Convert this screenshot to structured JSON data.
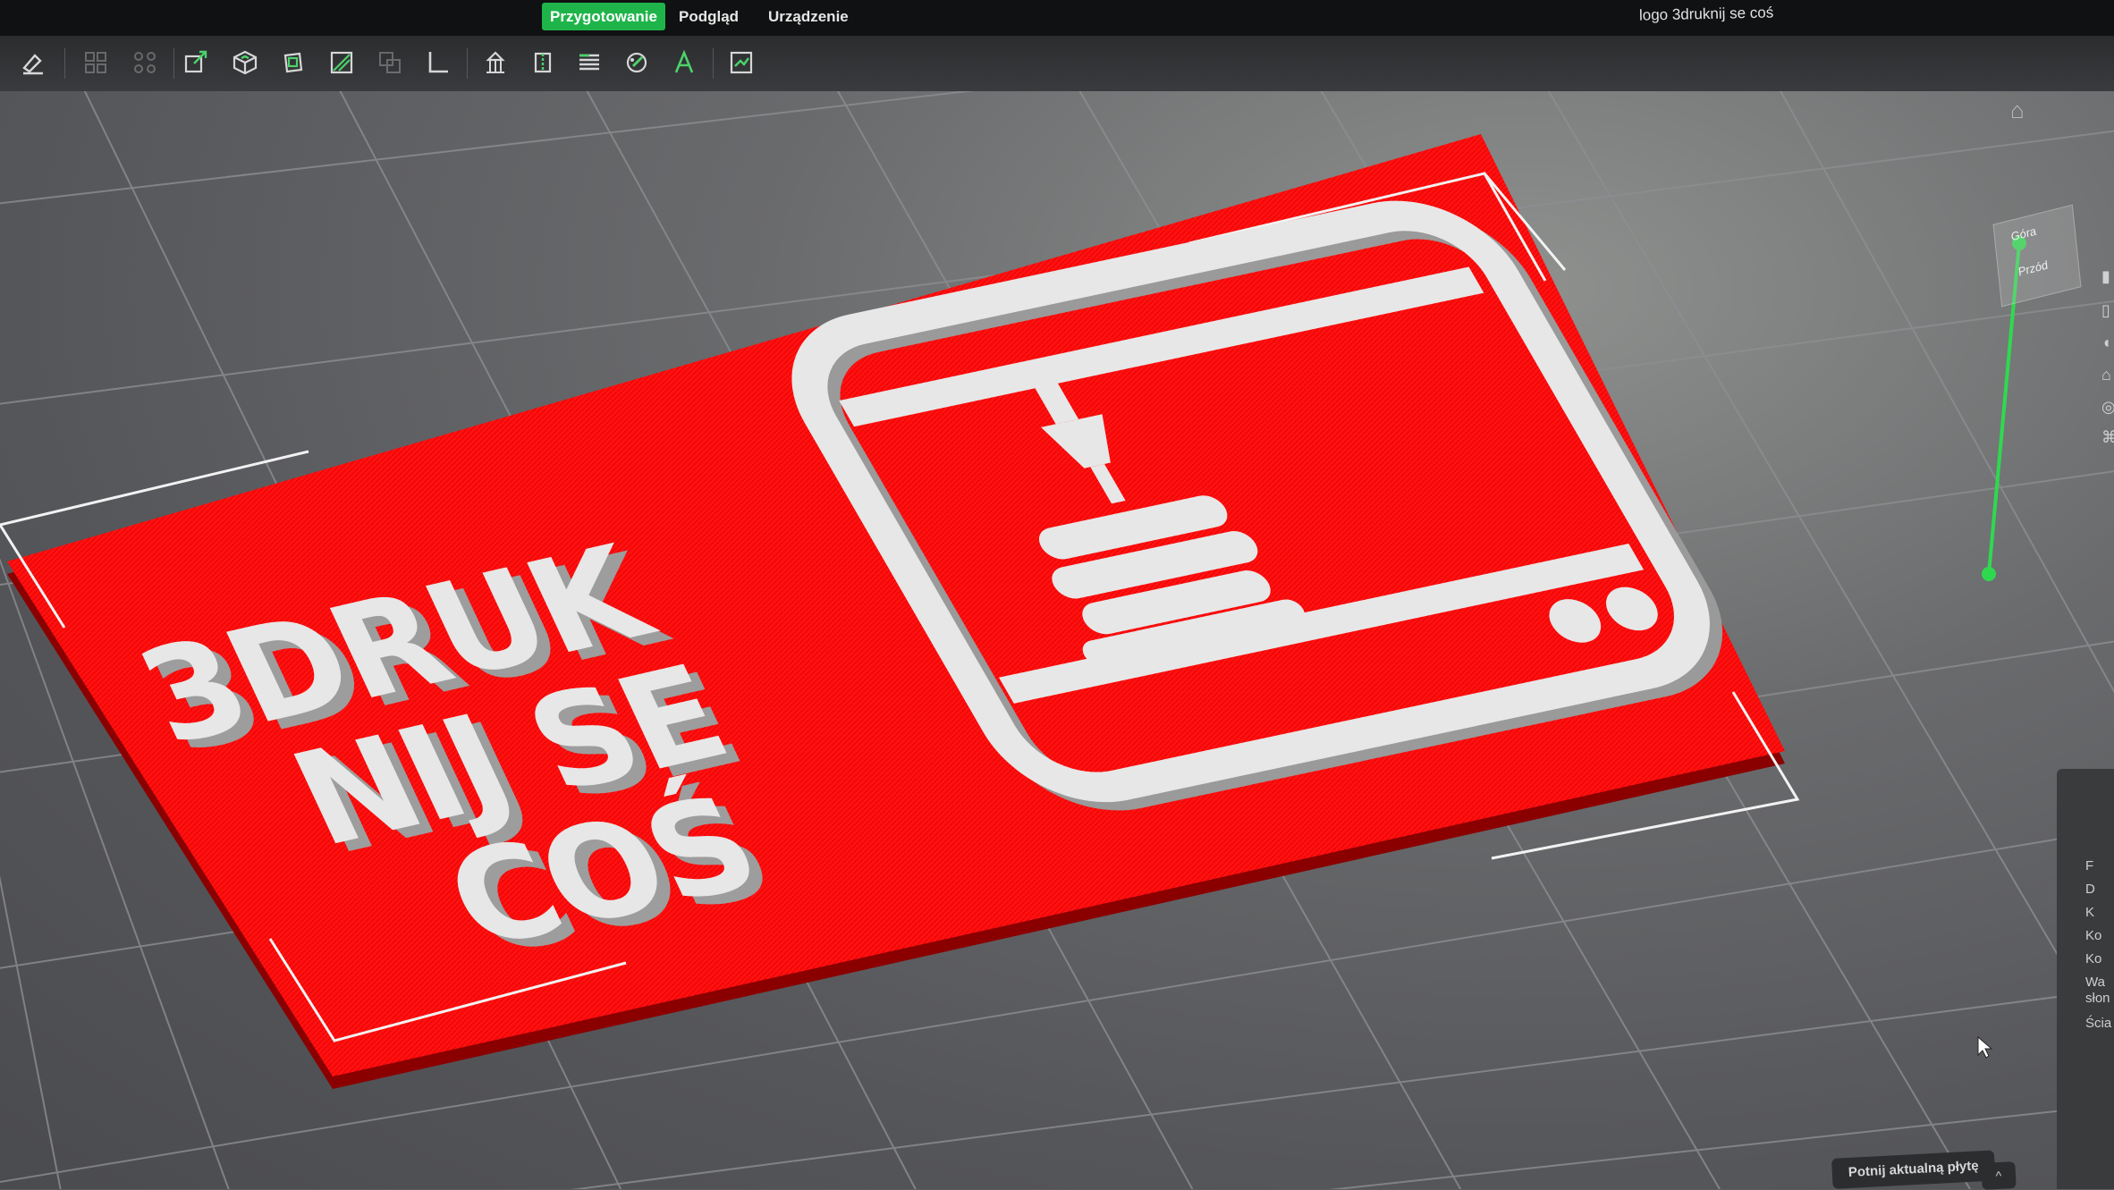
{
  "menubar": {
    "tabs": [
      {
        "label": "Przygotowanie",
        "active": true
      },
      {
        "label": "Podgląd",
        "active": false
      },
      {
        "label": "Urządzenie",
        "active": false
      }
    ],
    "project_title": "logo 3druknij se coś"
  },
  "toolbar": {
    "tools": [
      "paint-icon",
      "arrange-all-icon",
      "arrange-grid-icon",
      "scale-icon",
      "add-cube-icon",
      "hollow-icon",
      "cut-icon",
      "split-icon",
      "measure-icon",
      "support-icon",
      "seam-icon",
      "layer-icon",
      "color-paint-icon",
      "text-icon",
      "assembly-icon"
    ]
  },
  "model": {
    "text_lines": [
      "3DRUK",
      "NIJ SE",
      "COŚ"
    ],
    "plate_color": "#ff1010",
    "relief_color": "#e7e7e7"
  },
  "view_cube": {
    "top_label": "Góra",
    "front_label": "Przód"
  },
  "colors": {
    "accent": "#1fb44a",
    "menubar_bg": "#101112",
    "toolbar_bg": "#333437",
    "viewport_bg": "#5b5c60"
  },
  "side_panel": {
    "rows": [
      "F",
      "D",
      "K",
      "Ko",
      "Ko",
      "Wa",
      "słon",
      "Ścia"
    ]
  },
  "slice": {
    "button_label": "Potnij aktualną płytę",
    "arrow": "^"
  }
}
